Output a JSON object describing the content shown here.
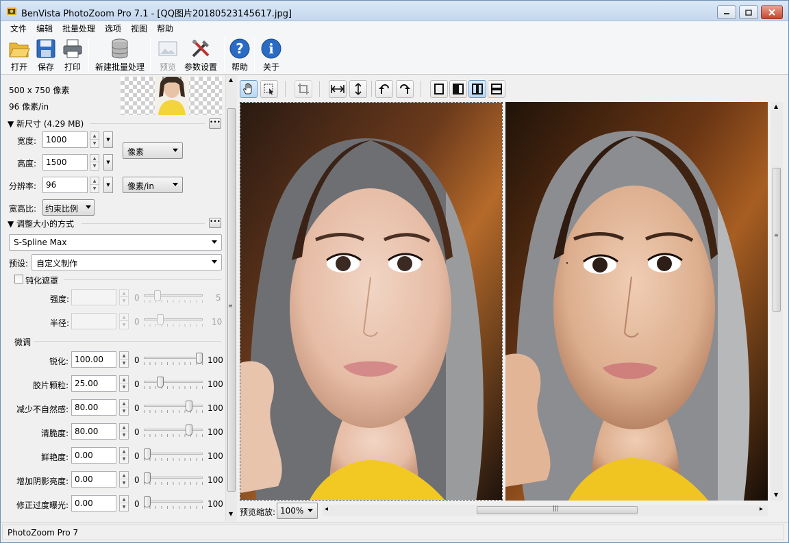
{
  "window": {
    "title": "BenVista PhotoZoom Pro 7.1 - [QQ图片20180523145617.jpg]"
  },
  "menu": [
    "文件",
    "编辑",
    "批量处理",
    "选项",
    "视图",
    "帮助"
  ],
  "toolbar": {
    "open": "打开",
    "save": "保存",
    "print": "打印",
    "new_batch": "新建批量处理",
    "preview": "预览",
    "settings": "参数设置",
    "help": "帮助",
    "about": "关于"
  },
  "original": {
    "pixels": "500 x 750 像素",
    "dpi": "96 像素/in"
  },
  "new_size": {
    "header": "▼ 新尺寸 (4.29 MB)",
    "width_label": "宽度:",
    "width_value": "1000",
    "height_label": "高度:",
    "height_value": "1500",
    "unit": "像素",
    "resolution_label": "分辨率:",
    "resolution_value": "96",
    "resolution_unit": "像素/in",
    "aspect_label": "宽高比:",
    "aspect_value": "约束比例"
  },
  "resize_method": {
    "header": "▼ 调整大小的方式",
    "method": "S-Spline Max",
    "preset_label": "预设:",
    "preset_value": "自定义制作"
  },
  "unsharp_mask": {
    "label": "钝化遮罩",
    "checked": false,
    "strength_label": "强度:",
    "strength_min": "0",
    "strength_max": "5",
    "strength_level": 0.2,
    "radius_label": "半径:",
    "radius_min": "0",
    "radius_max": "10",
    "radius_level": 0.25
  },
  "fine_tune": {
    "header": "微调",
    "rows": [
      {
        "label": "锐化:",
        "value": "100.00",
        "min": "0",
        "max": "100",
        "level": 1.0
      },
      {
        "label": "胶片颗粒:",
        "value": "25.00",
        "min": "0",
        "max": "100",
        "level": 0.25
      },
      {
        "label": "减少不自然感:",
        "value": "80.00",
        "min": "0",
        "max": "100",
        "level": 0.8
      },
      {
        "label": "清脆度:",
        "value": "80.00",
        "min": "0",
        "max": "100",
        "level": 0.8
      },
      {
        "label": "鲜艳度:",
        "value": "0.00",
        "min": "0",
        "max": "100",
        "level": 0.0
      },
      {
        "label": "增加阴影亮度:",
        "value": "0.00",
        "min": "0",
        "max": "100",
        "level": 0.0
      },
      {
        "label": "修正过度曝光:",
        "value": "0.00",
        "min": "0",
        "max": "100",
        "level": 0.0
      }
    ]
  },
  "preview": {
    "zoom_label": "预览缩放:",
    "zoom_value": "100%",
    "scroll_right_glyph": "▸",
    "scroll_left_glyph": "◂",
    "grip_glyph": "|||"
  },
  "status": {
    "text": "PhotoZoom Pro 7"
  },
  "colors": {
    "title_gradient_top": "#dbe8f6",
    "accent_blue": "#2a6bc4",
    "close_red": "#c6452c"
  }
}
